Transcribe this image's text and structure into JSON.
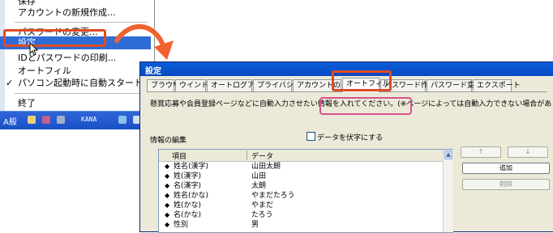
{
  "menu": {
    "items": [
      {
        "label": "保存",
        "checked": false,
        "selected": false
      },
      {
        "label": "アカウントの新規作成...",
        "checked": false,
        "selected": false
      },
      {
        "label": "パスワードの変更...",
        "checked": false,
        "selected": false
      },
      {
        "label": "設定",
        "checked": false,
        "selected": true
      },
      {
        "label": "IDとパスワードの印刷...",
        "checked": false,
        "selected": false
      },
      {
        "label": "オートフィル",
        "checked": false,
        "selected": false
      },
      {
        "label": "パソコン起動時に自動スタート",
        "checked": true,
        "selected": false
      },
      {
        "label": "終了",
        "checked": false,
        "selected": false
      }
    ],
    "check_mark": "✓"
  },
  "taskbar": {
    "ime": "A般",
    "kana": "KANA"
  },
  "window": {
    "title": "設定",
    "tabs": [
      "ブラウザ",
      "ウインドウ",
      "オートログアウト",
      "プライバシー",
      "アカウントの管理",
      "オートフィル",
      "パスワード作成",
      "パスワード変更",
      "エクスポート"
    ],
    "active_tab": "オートフィル",
    "description": "懸賞応募や会員登録ページなどに自動入力させたい情報を入れてください。(※ページによっては自動入力できない場合があります)",
    "section_label": "情報の編集",
    "checkbox_label": "データを伏字にする",
    "columns": [
      "項目",
      "データ"
    ],
    "rows": [
      {
        "key": "姓名(漢字)",
        "value": "山田太朗"
      },
      {
        "key": "姓(漢字)",
        "value": "山田"
      },
      {
        "key": "名(漢字)",
        "value": "太朗"
      },
      {
        "key": "姓名(かな)",
        "value": "やまだたろう"
      },
      {
        "key": "姓(かな)",
        "value": "やまだ"
      },
      {
        "key": "名(かな)",
        "value": "たろう"
      },
      {
        "key": "性別",
        "value": "男"
      }
    ],
    "buttons": {
      "up": "↑",
      "down": "↓",
      "add": "追加",
      "delete": "削除"
    }
  },
  "colors": {
    "highlight_red": "#e04a26",
    "highlight_pink": "#d9508f",
    "selection_blue": "#2f6dd6",
    "arrow_orange": "#f0622e"
  }
}
